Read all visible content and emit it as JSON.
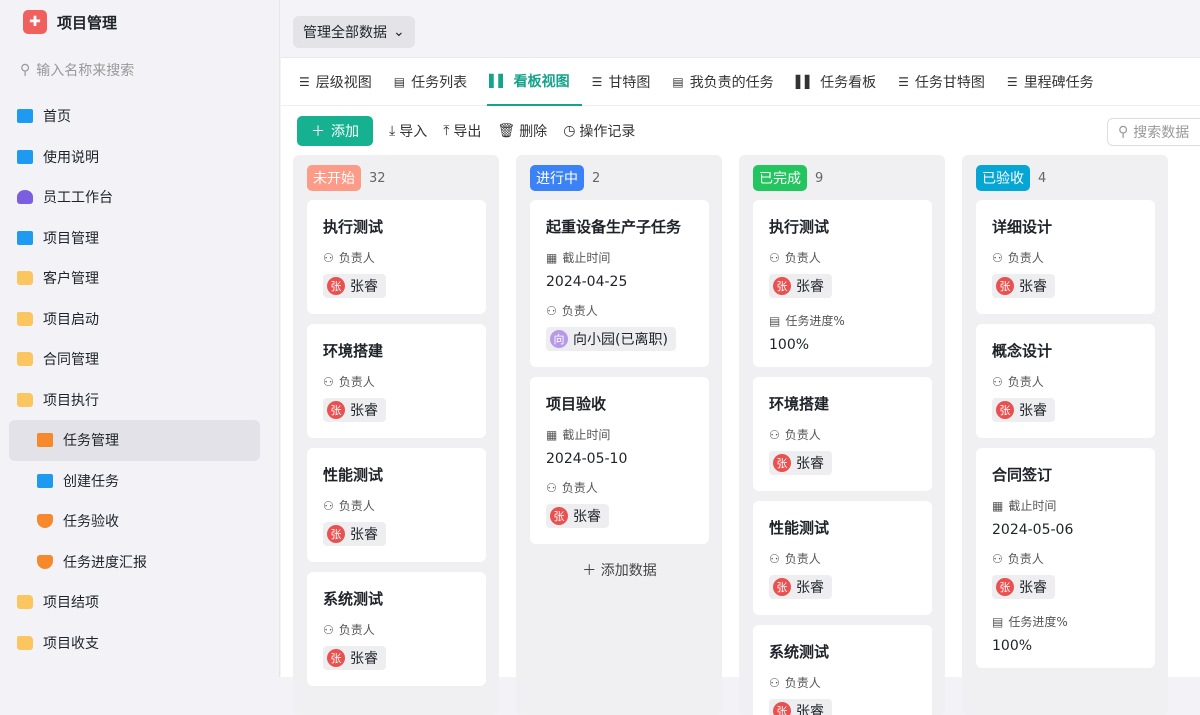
{
  "app": {
    "title": "项目管理",
    "search_placeholder": "输入名称来搜索"
  },
  "sidebar": {
    "items": [
      {
        "label": "首页",
        "icon": "home-icon",
        "color": "#1e9bf0"
      },
      {
        "label": "使用说明",
        "icon": "document-icon",
        "color": "#1e9bf0"
      },
      {
        "label": "员工工作台",
        "icon": "user-icon",
        "color": "#7b5fe0"
      },
      {
        "label": "项目管理",
        "icon": "document-icon",
        "color": "#1e9bf0"
      },
      {
        "label": "客户管理",
        "icon": "folder-icon",
        "color": "#fbc660"
      },
      {
        "label": "项目启动",
        "icon": "folder-icon",
        "color": "#fbc660"
      },
      {
        "label": "合同管理",
        "icon": "folder-icon",
        "color": "#fbc660"
      },
      {
        "label": "项目执行",
        "icon": "folder-open-icon",
        "color": "#fbc660"
      },
      {
        "label": "任务管理",
        "icon": "chart-icon",
        "color": "#f5892b",
        "sub": true,
        "active": true
      },
      {
        "label": "创建任务",
        "icon": "send-icon",
        "color": "#1e9bf0",
        "sub": true
      },
      {
        "label": "任务验收",
        "icon": "shield-icon",
        "color": "#f5892b",
        "sub": true
      },
      {
        "label": "任务进度汇报",
        "icon": "shield-icon",
        "color": "#f5892b",
        "sub": true
      },
      {
        "label": "项目结项",
        "icon": "folder-icon",
        "color": "#fbc660"
      },
      {
        "label": "项目收支",
        "icon": "folder-icon",
        "color": "#fbc660"
      }
    ]
  },
  "scope": {
    "label": "管理全部数据"
  },
  "tabs": [
    {
      "label": "层级视图",
      "icon": "☰"
    },
    {
      "label": "任务列表",
      "icon": "▤"
    },
    {
      "label": "看板视图",
      "icon": "▌▌",
      "active": true
    },
    {
      "label": "甘特图",
      "icon": "☰"
    },
    {
      "label": "我负责的任务",
      "icon": "▤"
    },
    {
      "label": "任务看板",
      "icon": "▌▌"
    },
    {
      "label": "任务甘特图",
      "icon": "☰"
    },
    {
      "label": "里程碑任务",
      "icon": "☰"
    }
  ],
  "toolbar": {
    "add": "添加",
    "import": "导入",
    "export": "导出",
    "delete": "删除",
    "log": "操作记录",
    "search_placeholder": "搜索数据"
  },
  "labels": {
    "owner": "负责人",
    "deadline": "截止时间",
    "progress": "任务进度%",
    "add_data": "添加数据"
  },
  "columns": [
    {
      "status": "未开始",
      "count": "32",
      "color": "#fc9b87",
      "cards": [
        {
          "title": "执行测试",
          "owner": "张睿",
          "avatar": "张"
        },
        {
          "title": "环境搭建",
          "owner": "张睿",
          "avatar": "张"
        },
        {
          "title": "性能测试",
          "owner": "张睿",
          "avatar": "张"
        },
        {
          "title": "系统测试",
          "owner": "张睿",
          "avatar": "张"
        }
      ]
    },
    {
      "status": "进行中",
      "count": "2",
      "color": "#3b82f6",
      "add": true,
      "cards": [
        {
          "title": "起重设备生产子任务",
          "deadline": "2024-04-25",
          "owner": "向小园(已离职)",
          "avatar": "向",
          "purple": true
        },
        {
          "title": "项目验收",
          "deadline": "2024-05-10",
          "owner": "张睿",
          "avatar": "张"
        }
      ]
    },
    {
      "status": "已完成",
      "count": "9",
      "color": "#22c55e",
      "cards": [
        {
          "title": "执行测试",
          "owner": "张睿",
          "avatar": "张",
          "progress": "100%"
        },
        {
          "title": "环境搭建",
          "owner": "张睿",
          "avatar": "张"
        },
        {
          "title": "性能测试",
          "owner": "张睿",
          "avatar": "张"
        },
        {
          "title": "系统测试",
          "owner": "张睿",
          "avatar": "张"
        }
      ]
    },
    {
      "status": "已验收",
      "count": "4",
      "color": "#06a6d4",
      "cards": [
        {
          "title": "详细设计",
          "owner": "张睿",
          "avatar": "张"
        },
        {
          "title": "概念设计",
          "owner": "张睿",
          "avatar": "张"
        },
        {
          "title": "合同签订",
          "deadline": "2024-05-06",
          "owner": "张睿",
          "avatar": "张",
          "progress": "100%"
        }
      ]
    }
  ]
}
